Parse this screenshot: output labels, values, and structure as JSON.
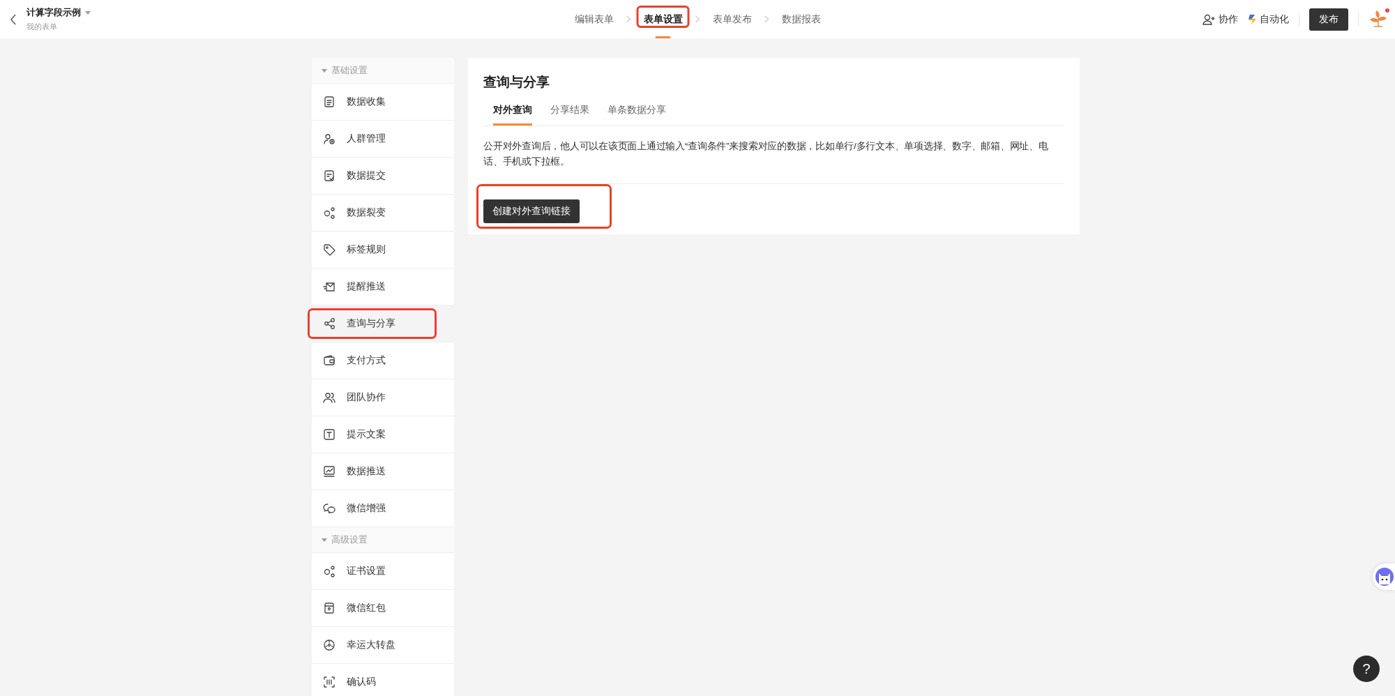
{
  "header": {
    "title": "计算字段示例",
    "subtitle": "我的表单",
    "steps": [
      {
        "label": "编辑表单",
        "selected": false,
        "highlighted": false
      },
      {
        "label": "表单设置",
        "selected": true,
        "highlighted": true
      },
      {
        "label": "表单发布",
        "selected": false,
        "highlighted": false
      },
      {
        "label": "数据报表",
        "selected": false,
        "highlighted": false
      }
    ],
    "actions": [
      {
        "kind": "collab",
        "label": "协作"
      },
      {
        "kind": "automation",
        "label": "自动化"
      }
    ],
    "publish_button": "发布",
    "notification": true
  },
  "sidebar": {
    "groups": [
      {
        "title": "基础设置",
        "expanded": true,
        "items": [
          {
            "label": "数据收集",
            "kind": "doc",
            "selected": false,
            "highlighted": false
          },
          {
            "label": "人群管理",
            "kind": "people",
            "selected": false,
            "highlighted": false
          },
          {
            "label": "数据提交",
            "kind": "submit",
            "selected": false,
            "highlighted": false
          },
          {
            "label": "数据裂变",
            "kind": "fission",
            "selected": false,
            "highlighted": false
          },
          {
            "label": "标签规则",
            "kind": "tag",
            "selected": false,
            "highlighted": false
          },
          {
            "label": "提醒推送",
            "kind": "mail",
            "selected": false,
            "highlighted": false
          },
          {
            "label": "查询与分享",
            "kind": "share",
            "selected": true,
            "highlighted": true
          },
          {
            "label": "支付方式",
            "kind": "wallet",
            "selected": false,
            "highlighted": false
          },
          {
            "label": "团队协作",
            "kind": "team",
            "selected": false,
            "highlighted": false
          },
          {
            "label": "提示文案",
            "kind": "text",
            "selected": false,
            "highlighted": false
          },
          {
            "label": "数据推送",
            "kind": "chart",
            "selected": false,
            "highlighted": false
          },
          {
            "label": "微信增强",
            "kind": "wechat",
            "selected": false,
            "highlighted": false
          }
        ]
      },
      {
        "title": "高级设置",
        "expanded": true,
        "items": [
          {
            "label": "证书设置",
            "kind": "fission",
            "selected": false,
            "highlighted": false
          },
          {
            "label": "微信红包",
            "kind": "envelope",
            "selected": false,
            "highlighted": false
          },
          {
            "label": "幸运大转盘",
            "kind": "wheel",
            "selected": false,
            "highlighted": false
          },
          {
            "label": "确认码",
            "kind": "scan",
            "selected": false,
            "highlighted": false
          }
        ]
      }
    ]
  },
  "panel": {
    "title": "查询与分享",
    "tabs": [
      {
        "label": "对外查询",
        "selected": true
      },
      {
        "label": "分享结果",
        "selected": false
      },
      {
        "label": "单条数据分享",
        "selected": false
      }
    ],
    "description": "公开对外查询后，他人可以在该页面上通过输入“查询条件”来搜索对应的数据，比如单行/多行文本、单项选择、数字、邮箱、网址、电话、手机或下拉框。",
    "create_button": {
      "label": "创建对外查询链接",
      "highlighted": true
    }
  },
  "help_button": "?"
}
